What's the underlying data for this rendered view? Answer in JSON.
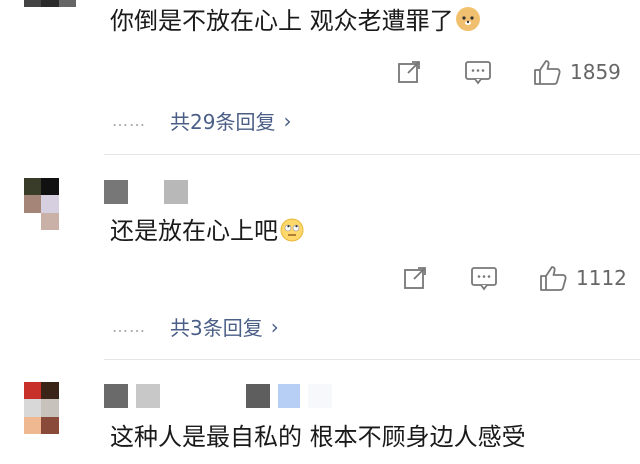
{
  "comments": [
    {
      "text": "你倒是不放在心上 观众老遭罪了",
      "emoji": "doge-emoji",
      "like_count": "1859",
      "replies_label": "共29条回复",
      "chevron": "›"
    },
    {
      "text": "还是放在心上吧",
      "emoji": "eye-roll-emoji",
      "like_count": "1112",
      "replies_label": "共3条回复",
      "chevron": "›"
    },
    {
      "text": "这种人是最自私的 根本不顾身边人感受"
    }
  ],
  "dots": "……",
  "icons": {
    "share": "share-icon",
    "comment": "comment-icon",
    "like": "thumbs-up-icon"
  },
  "colors": {
    "link": "#4a5e86",
    "meta": "#777777",
    "divider": "#e6e6e6"
  }
}
